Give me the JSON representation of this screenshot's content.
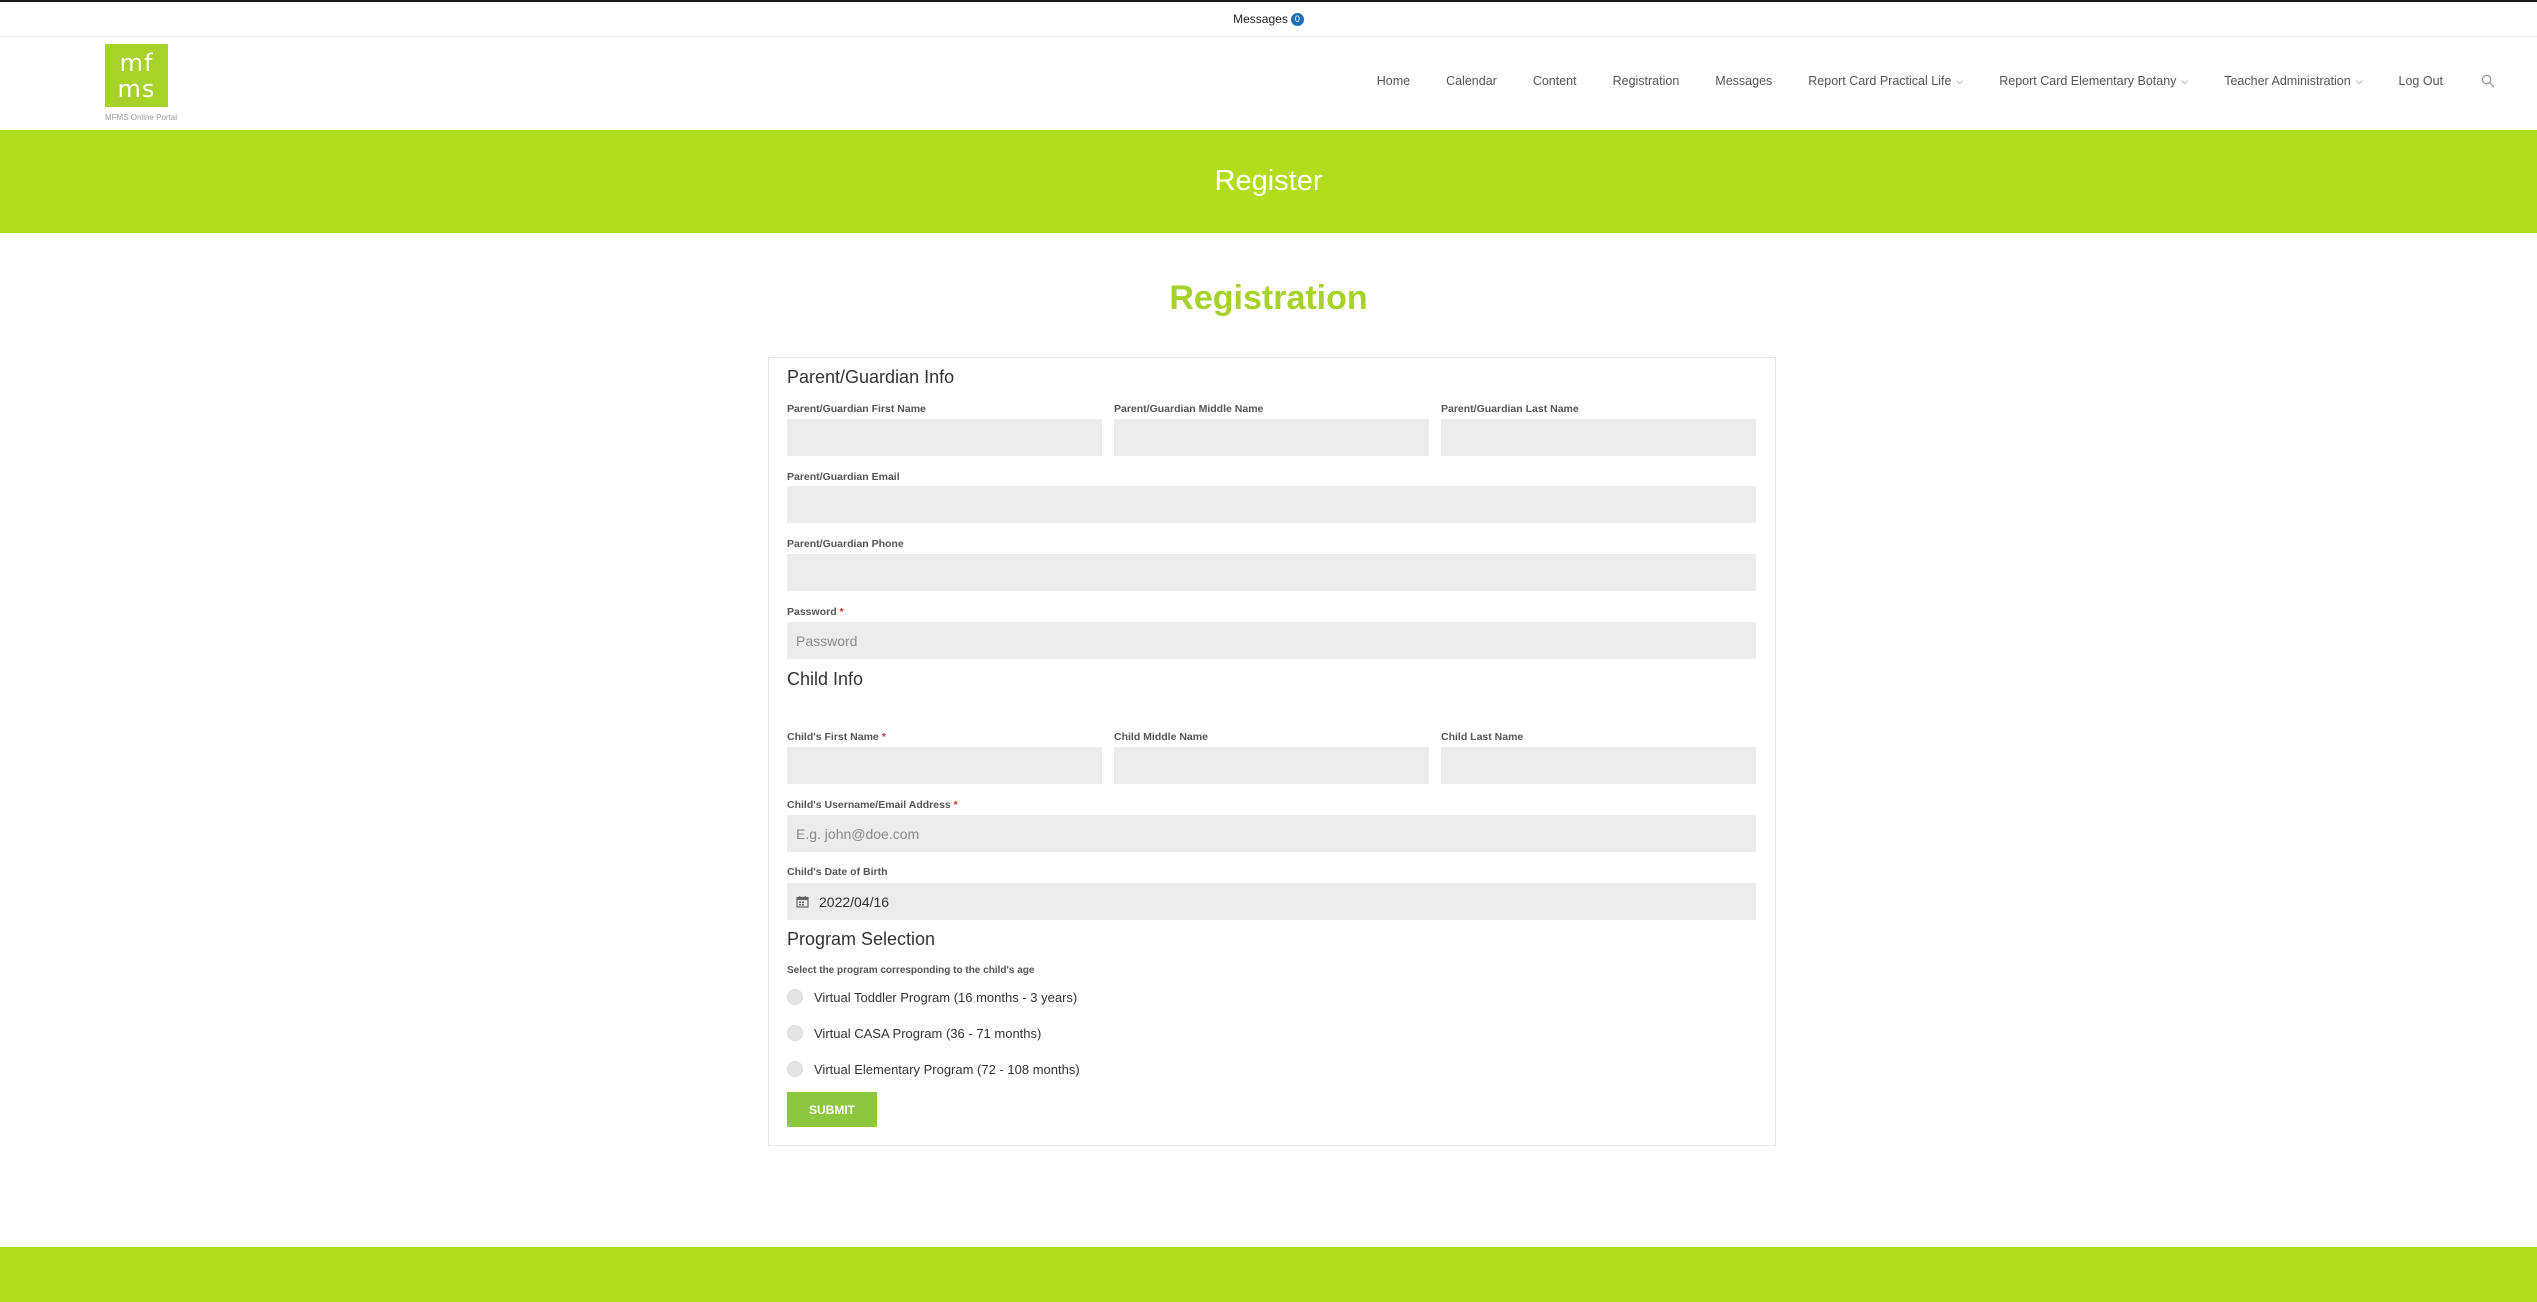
{
  "top_bar": {
    "messages_label": "Messages",
    "messages_count": "0"
  },
  "brand": {
    "logo_text_line1": "mf",
    "logo_text_line2": "ms",
    "caption": "MFMS Online Portal",
    "color": "#a6d22a"
  },
  "nav": {
    "items": [
      {
        "label": "Home",
        "dropdown": false
      },
      {
        "label": "Calendar",
        "dropdown": false
      },
      {
        "label": "Content",
        "dropdown": false
      },
      {
        "label": "Registration",
        "dropdown": false
      },
      {
        "label": "Messages",
        "dropdown": false
      },
      {
        "label": "Report Card Practical Life",
        "dropdown": true
      },
      {
        "label": "Report Card Elementary Botany",
        "dropdown": true
      },
      {
        "label": "Teacher Administration",
        "dropdown": true
      },
      {
        "label": "Log Out",
        "dropdown": false
      }
    ],
    "search_icon": "search-icon"
  },
  "banner": {
    "title": "Register",
    "color": "#b2dd1d"
  },
  "form": {
    "title": "Registration",
    "parent_section": "Parent/Guardian Info",
    "parent_first_name_label": "Parent/Guardian First Name",
    "parent_middle_name_label": "Parent/Guardian Middle Name",
    "parent_last_name_label": "Parent/Guardian Last Name",
    "parent_email_label": "Parent/Guardian Email",
    "parent_phone_label": "Parent/Guardian Phone",
    "password_label": "Password",
    "password_placeholder": "Password",
    "required_mark": "*",
    "child_section": "Child Info",
    "child_first_name_label": "Child's First Name",
    "child_middle_name_label": "Child Middle Name",
    "child_last_name_label": "Child Last Name",
    "child_username_label": "Child's Username/Email Address",
    "child_username_placeholder": "E.g. john@doe.com",
    "child_dob_label": "Child's Date of Birth",
    "child_dob_value": "2022/04/16",
    "program_section": "Program Selection",
    "program_hint": "Select the program corresponding to the child's age",
    "programs": [
      "Virtual Toddler Program (16 months - 3 years)",
      "Virtual CASA Program (36 - 71 months)",
      "Virtual Elementary Program (72 - 108 months)"
    ],
    "submit_label": "SUBMIT",
    "submit_color": "#8dc63f"
  }
}
